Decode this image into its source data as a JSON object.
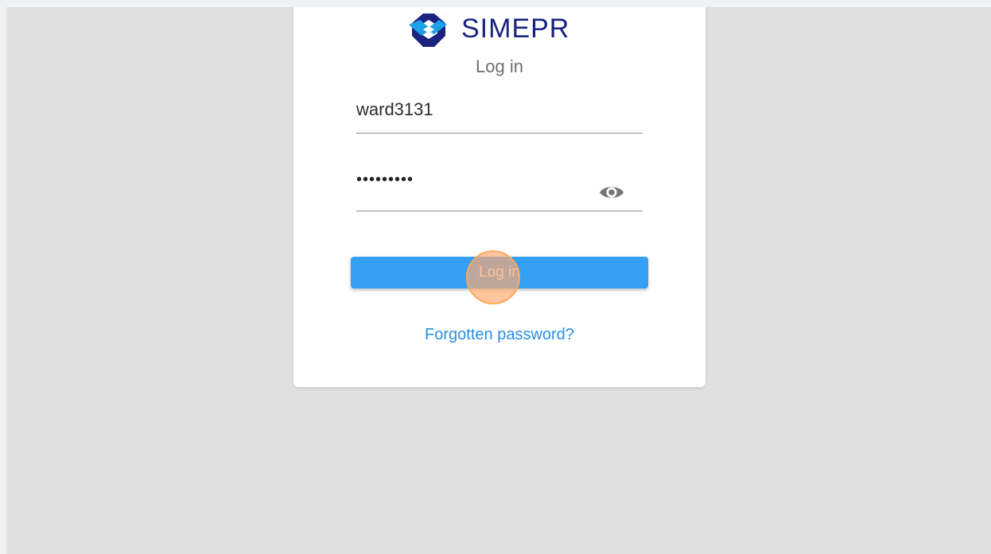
{
  "brand": {
    "name": "SIMEPR",
    "colors": {
      "primary": "#1a237e",
      "accent": "#1ea0e6"
    }
  },
  "login": {
    "title": "Log in",
    "username_value": "ward3131",
    "password_masked": "•••••••••",
    "password_toggle_icon": "eye-icon",
    "submit_label": "Log in",
    "forgot_password_label": "Forgotten password?"
  },
  "theme": {
    "button_color": "#359ff4",
    "link_color": "#2a8ee5",
    "page_background": "#e0e0e0",
    "click_indicator_color": "#ffa95c"
  }
}
